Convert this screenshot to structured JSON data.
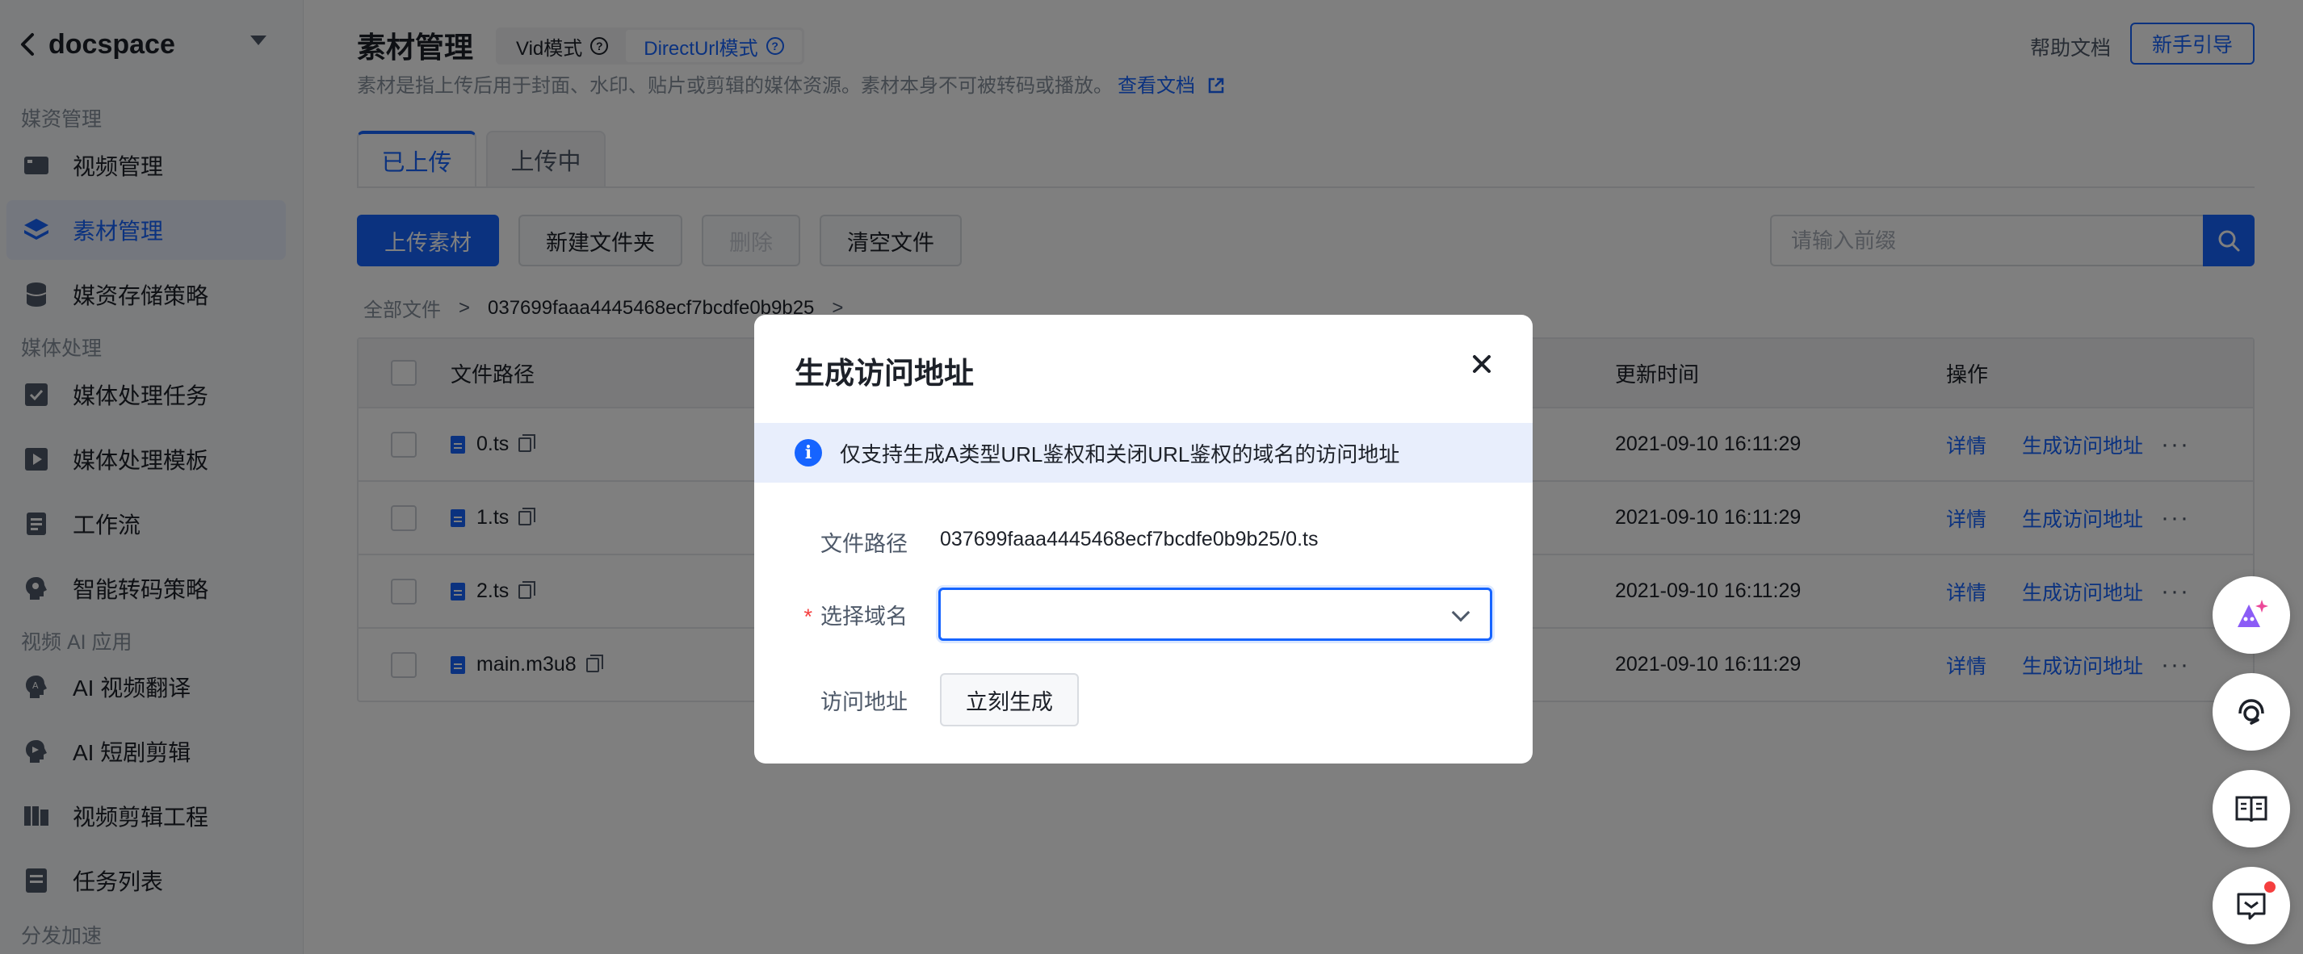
{
  "sidebar": {
    "title": "docspace",
    "sections": [
      {
        "label": "媒资管理"
      },
      {
        "label": "媒体处理"
      },
      {
        "label": "视频 AI 应用"
      },
      {
        "label": "分发加速"
      }
    ],
    "items": [
      {
        "label": "视频管理",
        "icon": "video-icon"
      },
      {
        "label": "素材管理",
        "icon": "layers-icon",
        "active": true
      },
      {
        "label": "媒资存储策略",
        "icon": "database-icon"
      },
      {
        "label": "媒体处理任务",
        "icon": "checkbox-icon"
      },
      {
        "label": "媒体处理模板",
        "icon": "play-template-icon"
      },
      {
        "label": "工作流",
        "icon": "workflow-icon"
      },
      {
        "label": "智能转码策略",
        "icon": "brain-icon"
      },
      {
        "label": "AI 视频翻译",
        "icon": "translate-icon"
      },
      {
        "label": "AI 短剧剪辑",
        "icon": "ai-edit-icon"
      },
      {
        "label": "视频剪辑工程",
        "icon": "film-edit-icon"
      },
      {
        "label": "任务列表",
        "icon": "task-list-icon"
      }
    ]
  },
  "header": {
    "title": "素材管理",
    "modes": [
      {
        "label": "Vid模式",
        "active": false
      },
      {
        "label": "DirectUrl模式",
        "active": true
      }
    ],
    "description": "素材是指上传后用于封面、水印、贴片或剪辑的媒体资源。素材本身不可被转码或播放。",
    "doc_link": "查看文档",
    "help": "帮助文档",
    "guide": "新手引导"
  },
  "tabs": [
    {
      "label": "已上传",
      "active": true
    },
    {
      "label": "上传中",
      "active": false
    }
  ],
  "toolbar": {
    "upload": "上传素材",
    "new_folder": "新建文件夹",
    "delete": "删除",
    "clear": "清空文件"
  },
  "search": {
    "placeholder": "请输入前缀"
  },
  "breadcrumb": {
    "root": "全部文件",
    "current": "037699faaa4445468ecf7bcdfe0b9b25"
  },
  "table": {
    "columns": {
      "path": "文件路径",
      "updated": "更新时间",
      "ops": "操作"
    },
    "rows": [
      {
        "path": "0.ts",
        "updated": "2021-09-10 16:11:29"
      },
      {
        "path": "1.ts",
        "updated": "2021-09-10 16:11:29"
      },
      {
        "path": "2.ts",
        "updated": "2021-09-10 16:11:29"
      },
      {
        "path": "main.m3u8",
        "updated": "2021-09-10 16:11:29"
      }
    ],
    "op_detail": "详情",
    "op_generate": "生成访问地址",
    "op_more": "···"
  },
  "modal": {
    "title": "生成访问地址",
    "info": "仅支持生成A类型URL鉴权和关闭URL鉴权的域名的访问地址",
    "path_label": "文件路径",
    "path_value": "037699faaa4445468ecf7bcdfe0b9b25/0.ts",
    "domain_required": "*",
    "domain_label": "选择域名",
    "domain_value": "",
    "url_label": "访问地址",
    "generate_btn": "立刻生成"
  },
  "colors": {
    "accent": "#1664ff",
    "danger": "#f53f3f"
  }
}
